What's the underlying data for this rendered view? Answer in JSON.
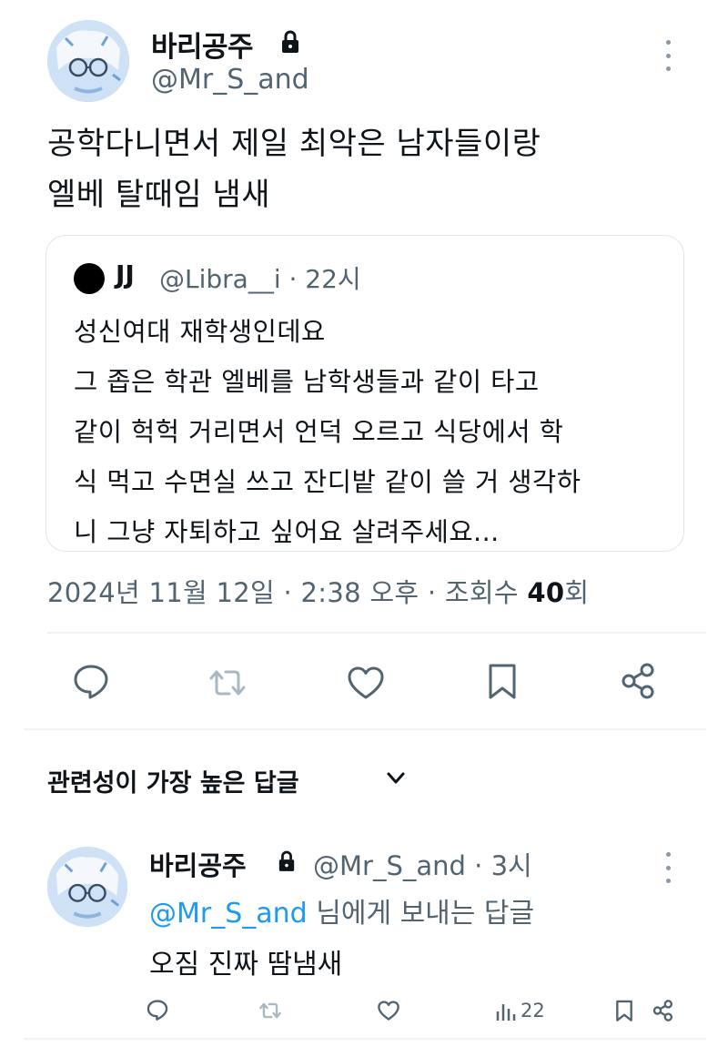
{
  "tweet": {
    "author_name": "바리공주",
    "author_handle": "@Mr_S_and",
    "text_lines": [
      "공학다니면서 제일 최악은 남자들이랑",
      "엘베 탈때임 냄새"
    ],
    "quote": {
      "author_name": "JJ",
      "meta": "@Libra__i · 22시",
      "text_lines": [
        "성신여대 재학생인데요",
        "그 좁은 학관 엘베를 남학생들과 같이 타고",
        "같이 헉헉 거리면서 언덕 오르고 식당에서 학",
        "식 먹고 수면실 쓰고 잔디밭 같이 쓸 거 생각하",
        "니 그냥 자퇴하고 싶어요 살려주세요..."
      ]
    },
    "date_time": "2024년 11월 12일 · 2:38 오후 · 조회수",
    "view_count": "40",
    "view_suffix": "회",
    "actions": [
      "reply-icon",
      "retweet-icon",
      "like-icon",
      "bookmark-icon",
      "share-icon"
    ]
  },
  "replies_section": {
    "title": "관련성이 가장 높은 답글"
  },
  "reply": {
    "author_name": "바리공주",
    "meta": "@Mr_S_and · 3시",
    "replying_to_handle": "@Mr_S_and",
    "replying_to_suffix": " 님에게 보내는 답글",
    "text": "오짐 진짜 땀냄새",
    "view_count": "22"
  },
  "colors": {
    "text": "#0f1419",
    "secondary": "#536471",
    "accent": "#1d9bf0",
    "divider": "#eff3f4",
    "border": "#dfe5ea"
  }
}
